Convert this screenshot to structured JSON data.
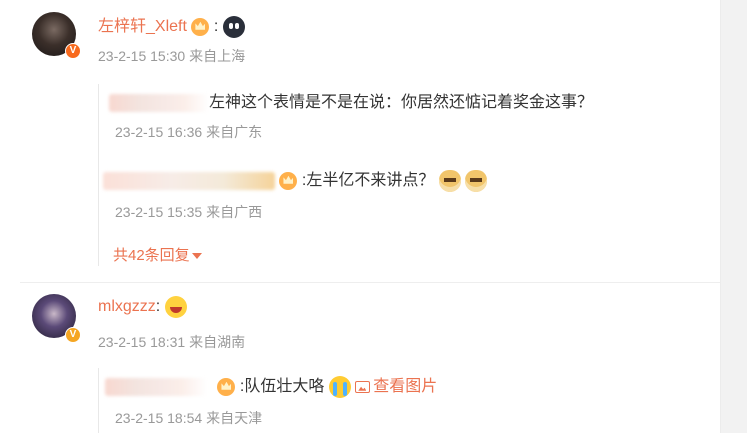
{
  "comments": [
    {
      "username": "左梓轩_Xleft",
      "colon": ":",
      "meta": "23-2-15 15:30 来自上海",
      "replies": [
        {
          "text": "左神这个表情是不是在说：你居然还惦记着奖金这事？",
          "meta": "23-2-15 16:36 来自广东"
        },
        {
          "text": ":左半亿不来讲点？",
          "meta": "23-2-15 15:35 来自广西"
        }
      ],
      "more_replies": "共42条回复"
    },
    {
      "username": "mlxgzzz",
      "colon": ":",
      "meta": "23-2-15 18:31 来自湖南",
      "replies": [
        {
          "text": ":队伍壮大咯",
          "view_image": "查看图片",
          "meta": "23-2-15 18:54 来自天津"
        }
      ]
    }
  ],
  "icons": {
    "verified": "verified-badge-icon",
    "crown": "vip-crown-icon",
    "emoji_1": "crying-face-emoji-icon",
    "emoji_doge": "doge-emoji-icon",
    "emoji_laugh": "laughing-emoji-icon",
    "emoji_sob": "sobbing-emoji-icon",
    "image": "image-icon",
    "caret": "caret-down-icon"
  },
  "colors": {
    "accent": "#eb7350",
    "meta": "#999999",
    "text": "#333333"
  }
}
